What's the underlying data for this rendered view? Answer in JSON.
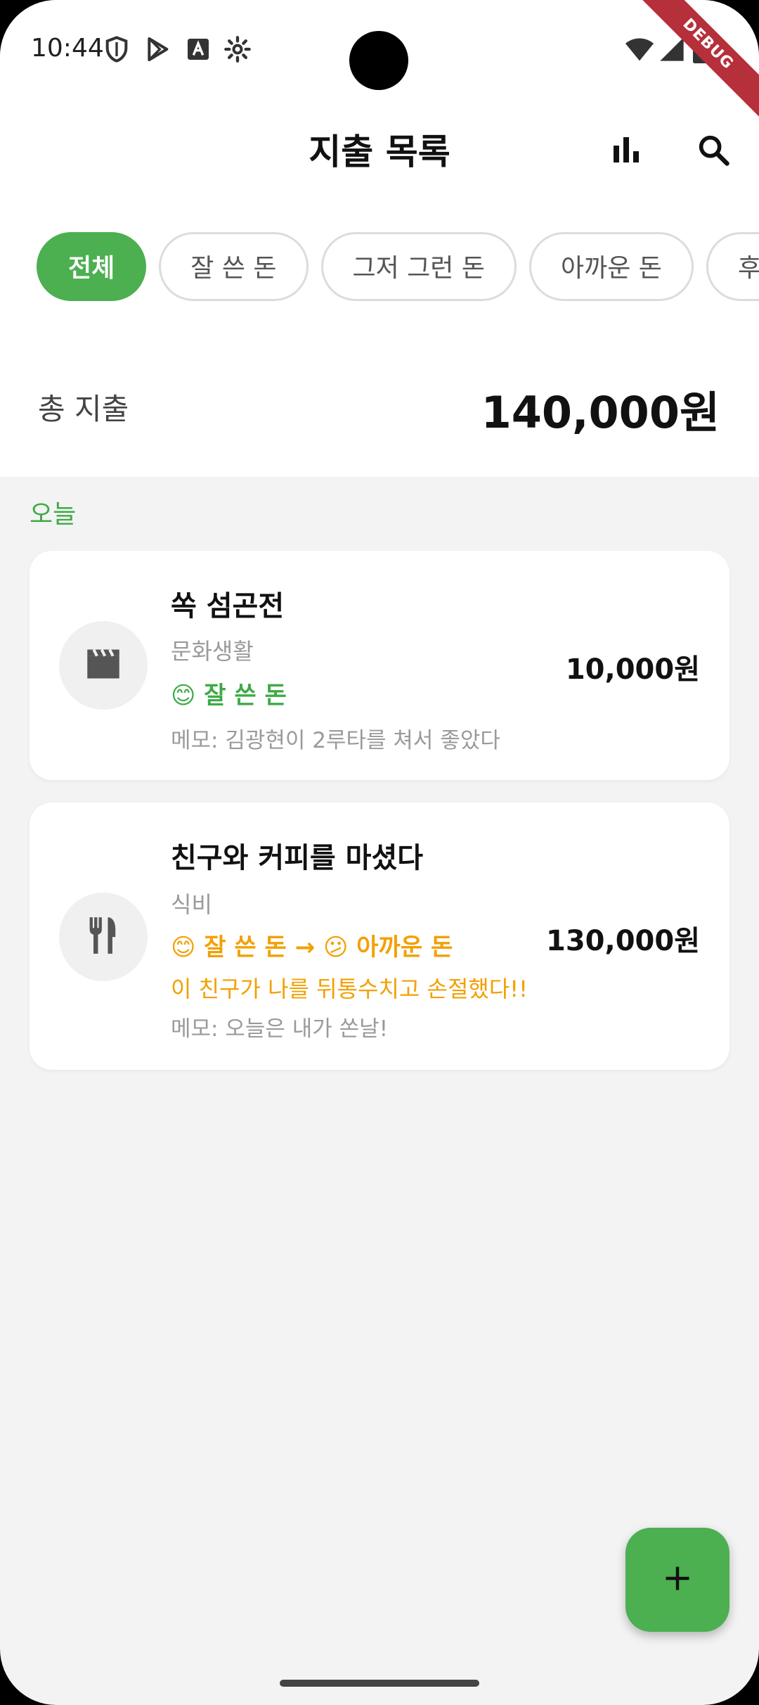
{
  "status_bar": {
    "time": "10:44",
    "left_icons": [
      "shield-icon",
      "play-store-icon",
      "text-a-icon",
      "gear-icon"
    ],
    "right_icons": [
      "wifi-icon",
      "signal-icon",
      "battery-icon"
    ],
    "debug_label": "DEBUG"
  },
  "app_bar": {
    "title": "지출 목록",
    "actions": [
      "bar-chart-icon",
      "search-icon"
    ]
  },
  "filters": {
    "chips": [
      "전체",
      "잘 쓴 돈",
      "그저 그런 돈",
      "아까운 돈",
      "후"
    ],
    "selected": "전체"
  },
  "summary": {
    "label": "총 지출",
    "total": "140,000원"
  },
  "section": {
    "label": "오늘"
  },
  "expenses": [
    {
      "icon": "movie-clapper-icon",
      "title": "쏙 섬곤전",
      "category": "문화생활",
      "evaluation": "😊 잘 쓴 돈",
      "evaluation_from": "",
      "evaluation_to": "",
      "reason": "",
      "memo": "메모: 김광현이 2루타를 쳐서 좋았다",
      "amount": "10,000원"
    },
    {
      "icon": "fork-knife-icon",
      "title": "친구와 커피를 마셨다",
      "category": "식비",
      "evaluation_from": "😊 잘 쓴 돈",
      "arrow": "→",
      "evaluation_to": "😕 아까운 돈",
      "reason": "이 친구가 나를 뒤통수치고 손절했다!!",
      "memo": "메모: 오늘은 내가 쏜날!",
      "amount": "130,000원"
    }
  ],
  "fab": {
    "icon": "plus-icon"
  },
  "colors": {
    "accent": "#4caf50",
    "good": "#3faa47",
    "bad": "#f2a000"
  }
}
